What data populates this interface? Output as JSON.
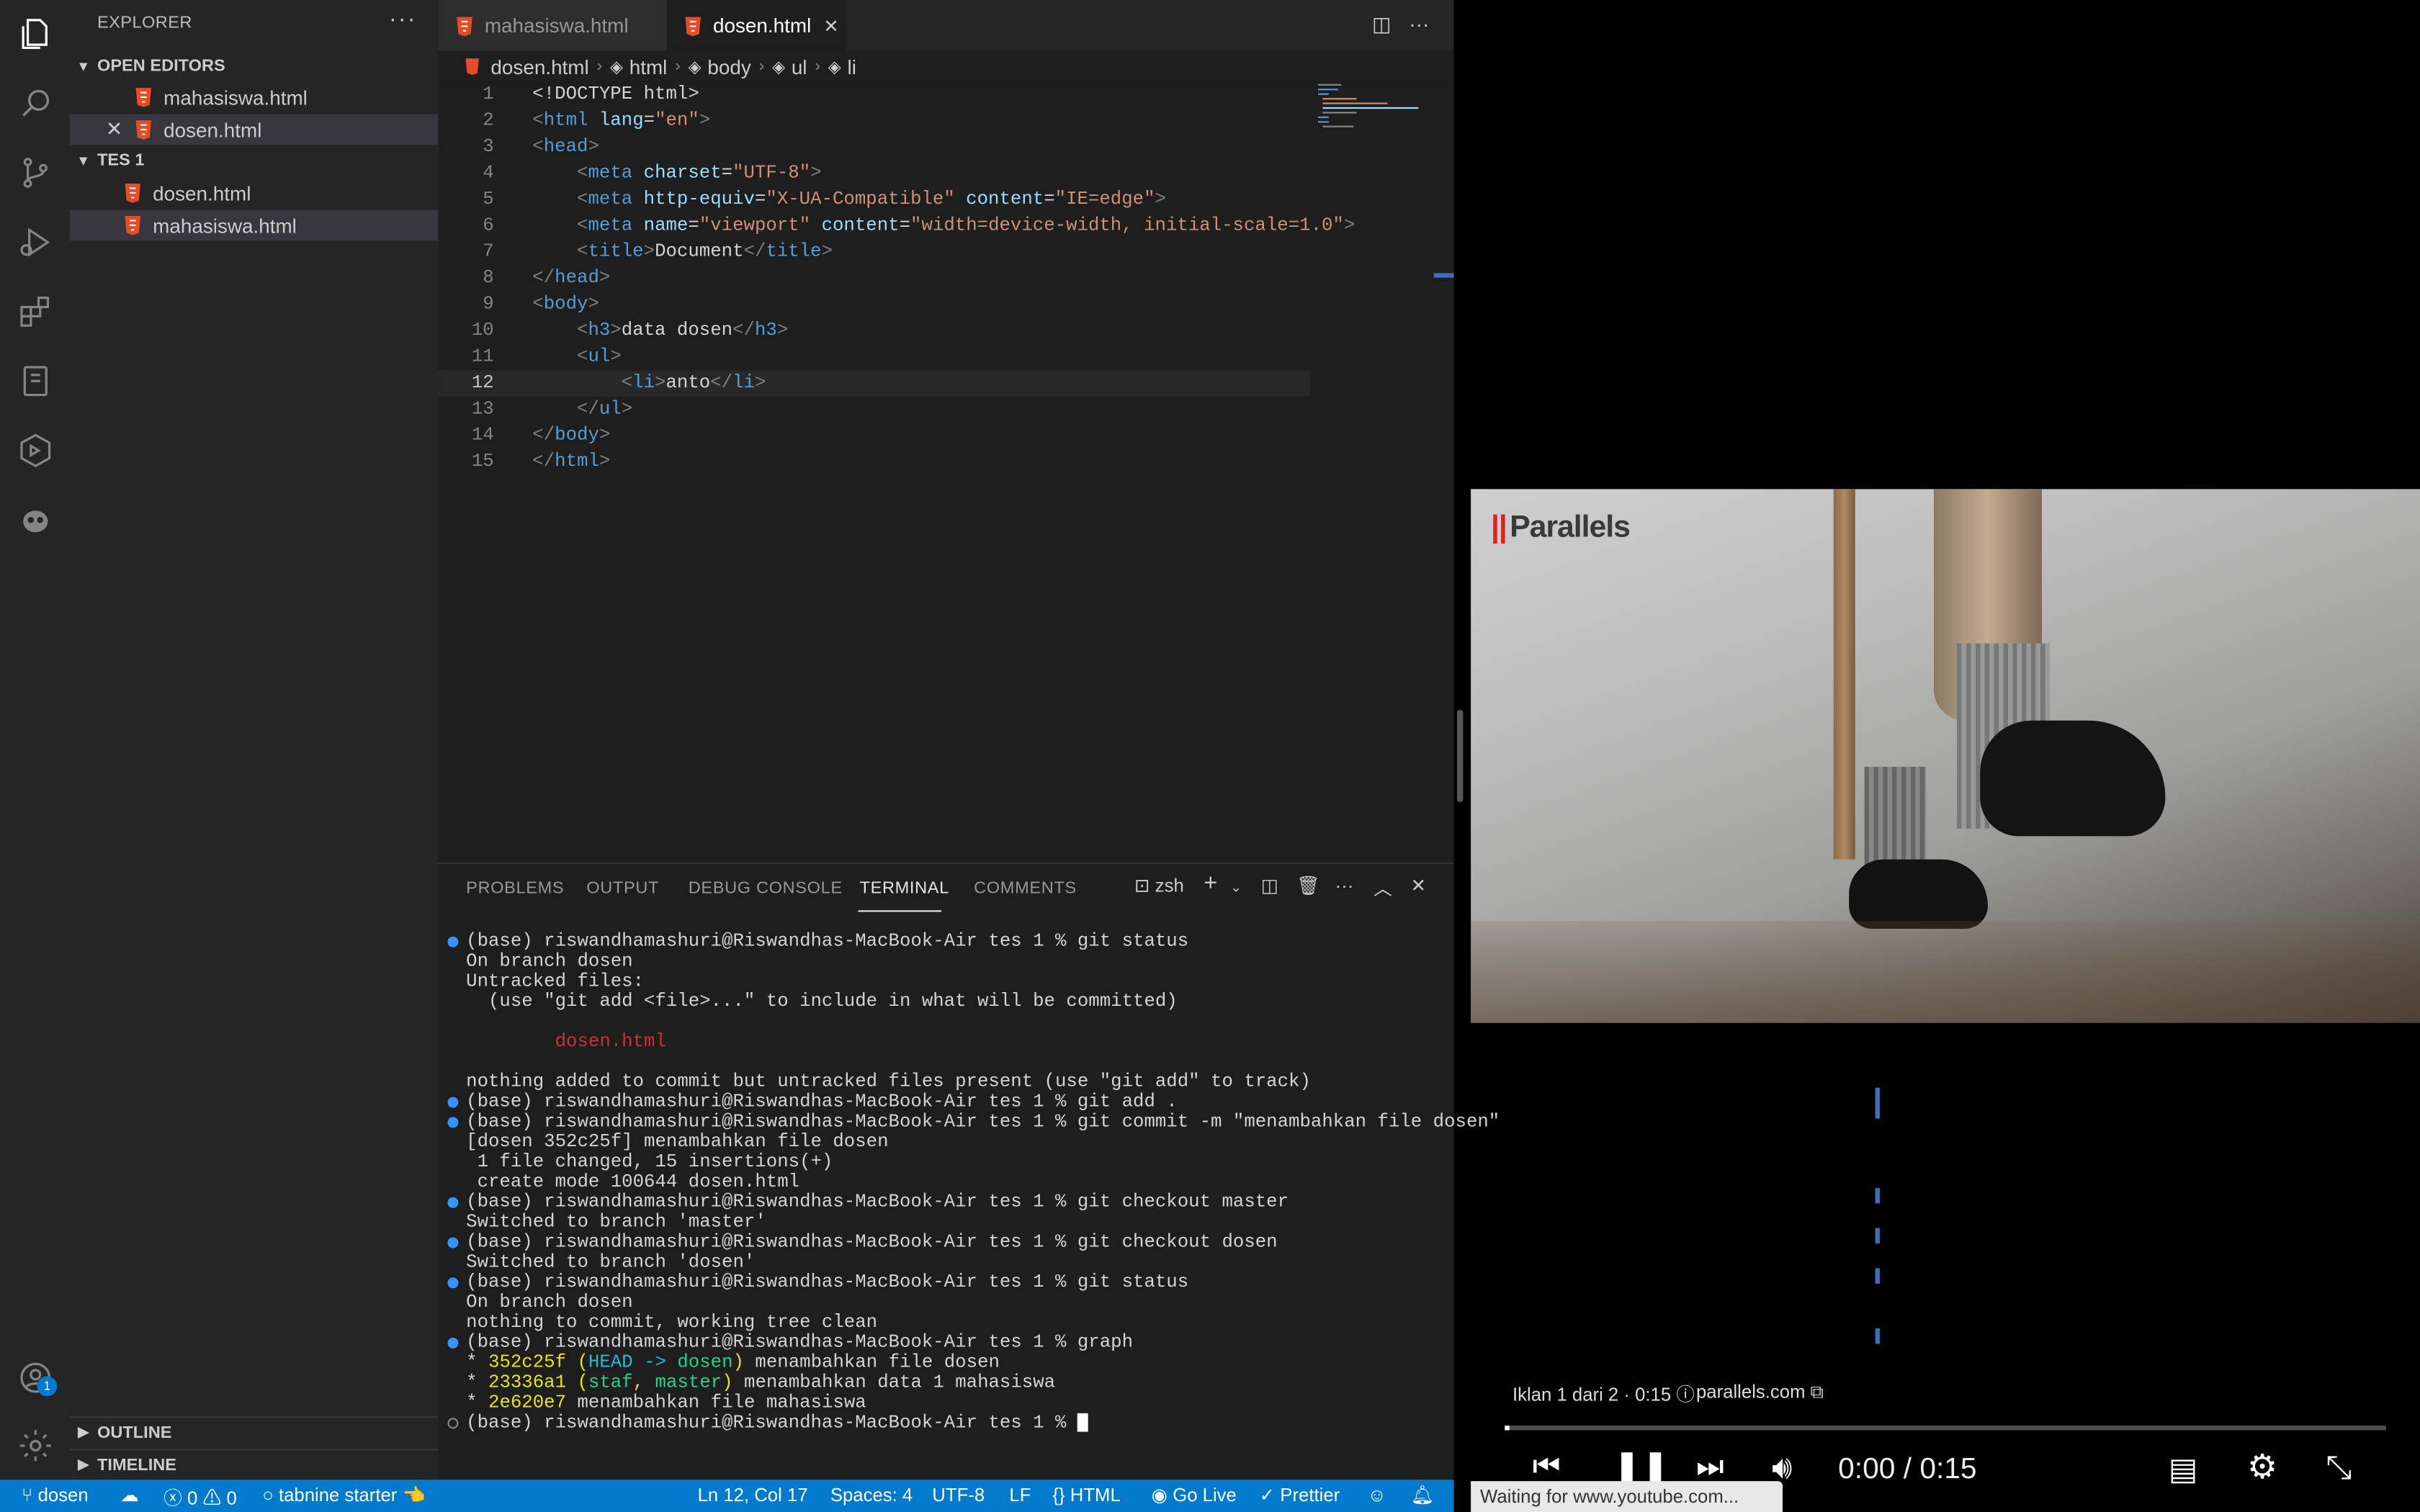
{
  "sidebar": {
    "title": "EXPLORER",
    "open_editors_label": "OPEN EDITORS",
    "open_editors": [
      {
        "name": "mahasiswa.html"
      },
      {
        "name": "dosen.html"
      }
    ],
    "folder_label": "TES 1",
    "folder_files": [
      {
        "name": "dosen.html"
      },
      {
        "name": "mahasiswa.html"
      }
    ],
    "outline_label": "OUTLINE",
    "timeline_label": "TIMELINE",
    "accounts_badge": "1"
  },
  "tabs": [
    {
      "label": "mahasiswa.html",
      "active": false
    },
    {
      "label": "dosen.html",
      "active": true
    }
  ],
  "breadcrumb": [
    "dosen.html",
    "html",
    "body",
    "ul",
    "li"
  ],
  "editor": {
    "line_numbers": [
      "1",
      "2",
      "3",
      "4",
      "5",
      "6",
      "7",
      "8",
      "9",
      "10",
      "11",
      "12",
      "13",
      "14",
      "15"
    ],
    "current_line": 12
  },
  "panel": {
    "tabs": [
      "PROBLEMS",
      "OUTPUT",
      "DEBUG CONSOLE",
      "TERMINAL",
      "COMMENTS"
    ],
    "active_tab": "TERMINAL",
    "shell": "zsh",
    "terminal_lines": [
      "(base) riswandhamashuri@Riswandhas-MacBook-Air tes 1 % git status",
      "On branch dosen",
      "Untracked files:",
      "  (use \"git add <file>...\" to include in what will be committed)",
      "        dosen.html",
      "nothing added to commit but untracked files present (use \"git add\" to track)",
      "(base) riswandhamashuri@Riswandhas-MacBook-Air tes 1 % git add .",
      "(base) riswandhamashuri@Riswandhas-MacBook-Air tes 1 % git commit -m \"menambahkan file dosen\"",
      "[dosen 352c25f] menambahkan file dosen",
      " 1 file changed, 15 insertions(+)",
      " create mode 100644 dosen.html",
      "(base) riswandhamashuri@Riswandhas-MacBook-Air tes 1 % git checkout master",
      "Switched to branch 'master'",
      "(base) riswandhamashuri@Riswandhas-MacBook-Air tes 1 % git checkout dosen",
      "Switched to branch 'dosen'",
      "(base) riswandhamashuri@Riswandhas-MacBook-Air tes 1 % git status",
      "On branch dosen",
      "nothing to commit, working tree clean",
      "(base) riswandhamashuri@Riswandhas-MacBook-Air tes 1 % graph",
      "(base) riswandhamashuri@Riswandhas-MacBook-Air tes 1 % "
    ],
    "graph": [
      {
        "hash": "352c25f",
        "refs_head": "HEAD -> ",
        "refs_branch": "dosen",
        "msg": " menambahkan file dosen"
      },
      {
        "hash": "23336a1",
        "refs_a": "staf",
        "refs_b": "master",
        "msg": " menambahkan data 1 mahasiswa"
      },
      {
        "hash": "2e620e7",
        "msg": " menambahkan file mahasiswa"
      }
    ]
  },
  "status": {
    "branch": "dosen",
    "errors": "0",
    "warnings": "0",
    "tabnine": "tabnine starter",
    "position": "Ln 12, Col 17",
    "spaces": "Spaces: 4",
    "encoding": "UTF-8",
    "eol": "LF",
    "language": "HTML",
    "golive": "Go Live",
    "prettier": "Prettier"
  },
  "video": {
    "brand": "Parallels",
    "ad_info": "Iklan 1 dari 2 · 0:15",
    "ad_link": "parallels.com",
    "time": "0:00 / 0:15",
    "progress": 0.005,
    "status_tooltip": "Waiting for www.youtube.com..."
  },
  "colors": {
    "accent": "#007acc",
    "html_icon": "#e44d26"
  }
}
